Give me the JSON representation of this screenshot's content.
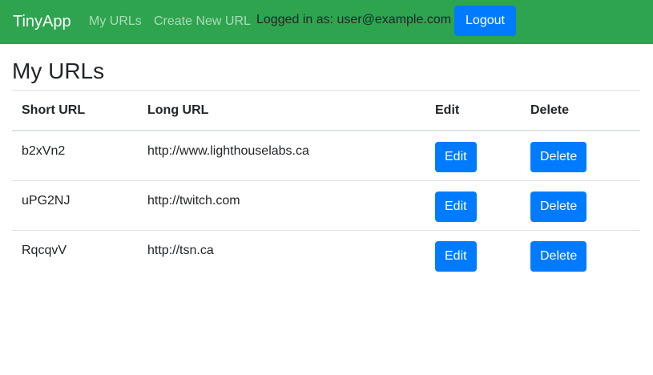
{
  "navbar": {
    "brand": "TinyApp",
    "links": [
      {
        "label": "My URLs"
      },
      {
        "label": "Create New URL"
      }
    ],
    "login_status": "Logged in as: user@example.com",
    "logout_label": "Logout",
    "colors": {
      "navbar_bg": "#2ea44f",
      "button_bg": "#007bff"
    }
  },
  "main": {
    "title": "My URLs",
    "table": {
      "headers": [
        "Short URL",
        "Long URL",
        "Edit",
        "Delete"
      ],
      "rows": [
        {
          "short_url": "b2xVn2",
          "long_url": "http://www.lighthouselabs.ca",
          "edit_label": "Edit",
          "delete_label": "Delete"
        },
        {
          "short_url": "uPG2NJ",
          "long_url": "http://twitch.com",
          "edit_label": "Edit",
          "delete_label": "Delete"
        },
        {
          "short_url": "RqcqvV",
          "long_url": "http://tsn.ca",
          "edit_label": "Edit",
          "delete_label": "Delete"
        }
      ]
    }
  }
}
